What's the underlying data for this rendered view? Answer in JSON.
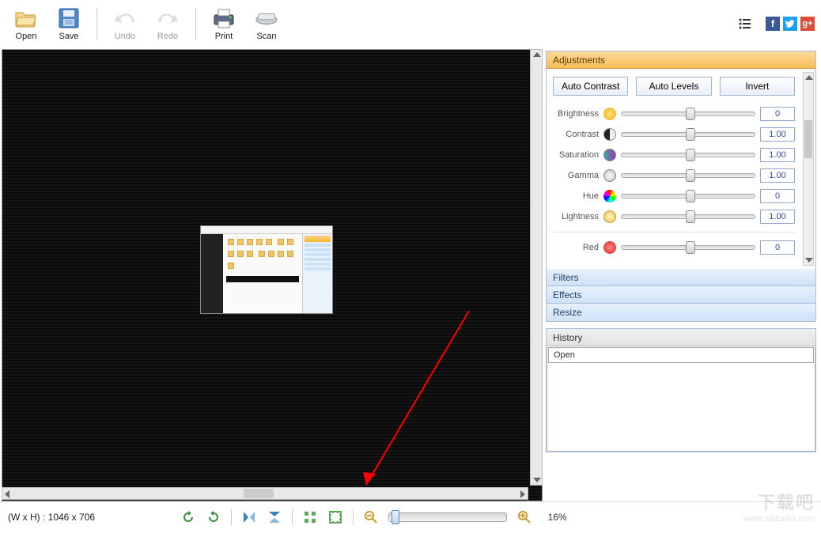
{
  "toolbar": {
    "open": "Open",
    "save": "Save",
    "undo": "Undo",
    "redo": "Redo",
    "print": "Print",
    "scan": "Scan"
  },
  "status": {
    "dimensions": "(W x H) : 1046 x 706",
    "zoom": "16%"
  },
  "panels": {
    "adjustments": "Adjustments",
    "filters": "Filters",
    "effects": "Effects",
    "resize": "Resize",
    "history": "History"
  },
  "adjustments": {
    "autoContrast": "Auto Contrast",
    "autoLevels": "Auto Levels",
    "invert": "Invert",
    "brightness": {
      "label": "Brightness",
      "value": "0"
    },
    "contrast": {
      "label": "Contrast",
      "value": "1.00"
    },
    "saturation": {
      "label": "Saturation",
      "value": "1.00"
    },
    "gamma": {
      "label": "Gamma",
      "value": "1.00"
    },
    "hue": {
      "label": "Hue",
      "value": "0"
    },
    "lightness": {
      "label": "Lightness",
      "value": "1.00"
    },
    "red": {
      "label": "Red",
      "value": "0"
    }
  },
  "history_items": {
    "0": "Open"
  },
  "watermark": {
    "brand": "下载吧",
    "url": "www.xiazaiba.com"
  }
}
